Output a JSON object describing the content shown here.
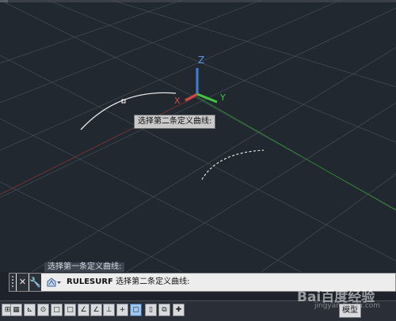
{
  "viewport": {
    "axis_labels": {
      "x": "X",
      "y": "Y",
      "z": "Z"
    },
    "colors": {
      "x": "#d44848",
      "y": "#3fc73f",
      "z": "#3f7fd6",
      "curve": "#e6e6e6",
      "grid": "#4a525c"
    }
  },
  "tooltip": {
    "text": "选择第二条定义曲线:"
  },
  "command_history": {
    "text": "选择第一条定义曲线:"
  },
  "command_line": {
    "close_icon": "close-icon",
    "customize_icon": "wrench-icon",
    "recent_icon": "recent-commands-icon",
    "command_name": "RULESURF",
    "prompt": "选择第二条定义曲线:"
  },
  "statusbar": {
    "buttons": [
      {
        "icon": "infer-constraints-icon",
        "on": false
      },
      {
        "icon": "snap-icon",
        "on": false
      },
      {
        "icon": "grid-display-icon",
        "on": false
      },
      {
        "icon": "ortho-icon",
        "on": false
      },
      {
        "icon": "polar-tracking-icon",
        "on": false
      },
      {
        "icon": "object-snap-icon",
        "on": false
      },
      {
        "icon": "3d-object-snap-icon",
        "on": false
      },
      {
        "icon": "object-snap-tracking-icon",
        "on": false
      },
      {
        "icon": "dynamic-ucs-icon",
        "on": false
      },
      {
        "icon": "dynamic-input-icon",
        "on": false
      },
      {
        "icon": "lineweight-icon",
        "on": false
      },
      {
        "icon": "transparency-icon",
        "on": true
      },
      {
        "icon": "quick-properties-icon",
        "on": false
      },
      {
        "icon": "selection-cycling-icon",
        "on": false
      },
      {
        "icon": "annotation-monitor-icon",
        "on": false
      }
    ],
    "layout_label": "模型"
  },
  "watermark": {
    "brand": "Bai百度经验",
    "url": "jingyan.baidu.com"
  }
}
